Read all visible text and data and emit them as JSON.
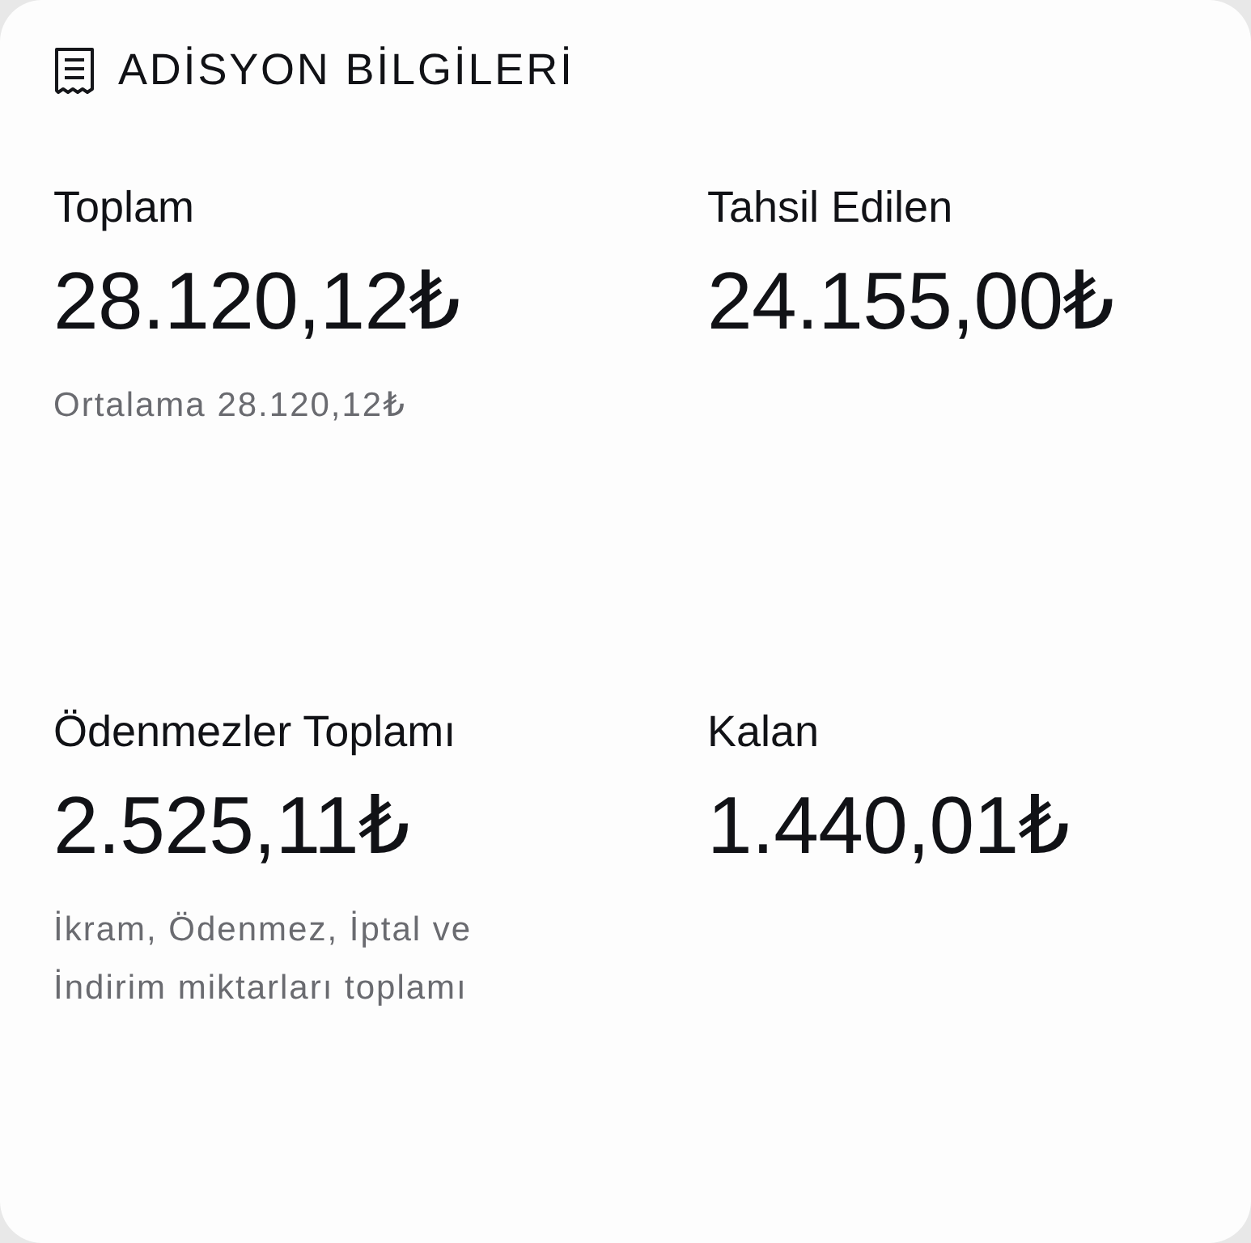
{
  "header": {
    "title": "ADİSYON BİLGİLERİ"
  },
  "stats": [
    {
      "label": "Toplam",
      "value": "28.120,12₺",
      "note": "Ortalama 28.120,12₺"
    },
    {
      "label": "Tahsil Edilen",
      "value": "24.155,00₺"
    },
    {
      "label": "Ödenmezler Toplamı",
      "value": "2.525,11₺",
      "note": "İkram, Ödenmez, İptal ve İndirim miktarları toplamı"
    },
    {
      "label": "Kalan",
      "value": "1.440,01₺"
    }
  ]
}
